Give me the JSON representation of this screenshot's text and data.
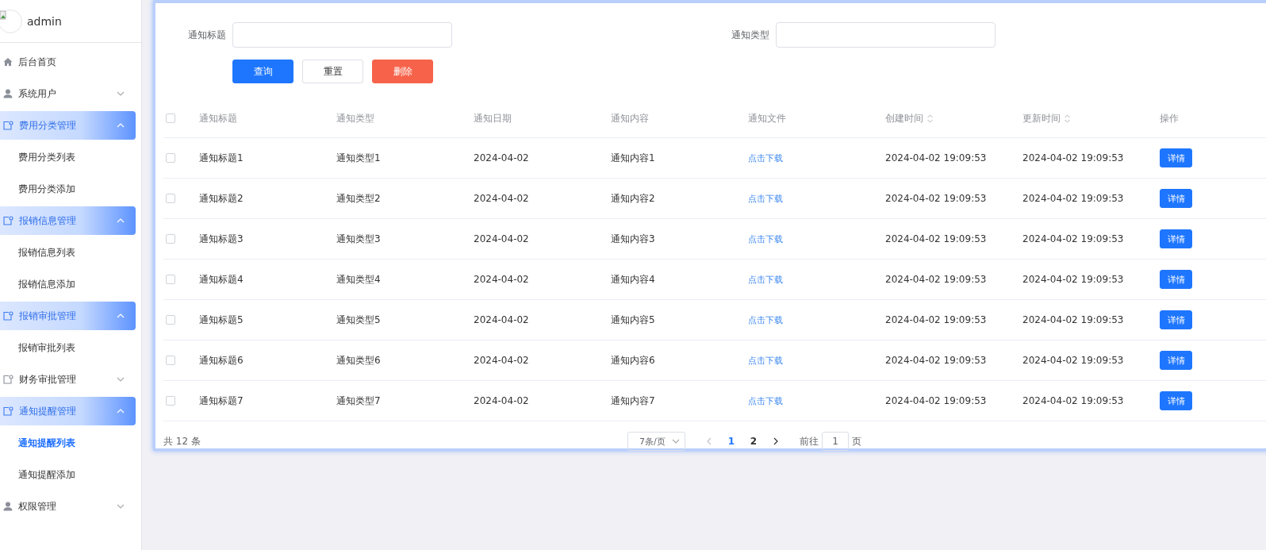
{
  "sidebar": {
    "user": {
      "name": "admin"
    },
    "items": [
      {
        "label": "后台首页",
        "kind": "home"
      },
      {
        "label": "系统用户",
        "kind": "people",
        "expanded": false
      },
      {
        "label": "费用分类管理",
        "kind": "folder",
        "expanded": true,
        "children": [
          {
            "label": "费用分类列表",
            "selected": false
          },
          {
            "label": "费用分类添加",
            "selected": false
          }
        ]
      },
      {
        "label": "报销信息管理",
        "kind": "folder",
        "expanded": true,
        "children": [
          {
            "label": "报销信息列表",
            "selected": false
          },
          {
            "label": "报销信息添加",
            "selected": false
          }
        ]
      },
      {
        "label": "报销审批管理",
        "kind": "folder",
        "expanded": true,
        "children": [
          {
            "label": "报销审批列表",
            "selected": false
          }
        ]
      },
      {
        "label": "财务审批管理",
        "kind": "folder",
        "expanded": false
      },
      {
        "label": "通知提醒管理",
        "kind": "folder",
        "expanded": true,
        "children": [
          {
            "label": "通知提醒列表",
            "selected": true
          },
          {
            "label": "通知提醒添加",
            "selected": false
          }
        ]
      },
      {
        "label": "权限管理",
        "kind": "people",
        "expanded": false
      }
    ]
  },
  "search": {
    "fields": [
      {
        "label": "通知标题"
      },
      {
        "label": "通知类型"
      }
    ],
    "buttons": [
      {
        "label": "查询",
        "kind": "primary"
      },
      {
        "label": "重置",
        "kind": "plain"
      },
      {
        "label": "删除",
        "kind": "danger"
      }
    ]
  },
  "table": {
    "all_checked": false,
    "columns": [
      {
        "label": "通知标题",
        "sortable": false
      },
      {
        "label": "通知类型",
        "sortable": false
      },
      {
        "label": "通知日期",
        "sortable": false
      },
      {
        "label": "通知内容",
        "sortable": false
      },
      {
        "label": "通知文件",
        "sortable": false
      },
      {
        "label": "创建时间",
        "sortable": true
      },
      {
        "label": "更新时间",
        "sortable": true
      },
      {
        "label": "操作",
        "sortable": false
      }
    ],
    "rows": [
      {
        "checked": false,
        "cells": [
          "通知标题1",
          "通知类型1",
          "2024-04-02",
          "通知内容1"
        ],
        "file": "点击下载",
        "created": "2024-04-02 19:09:53",
        "updated": "2024-04-02 19:09:53",
        "action": "详情"
      },
      {
        "checked": false,
        "cells": [
          "通知标题2",
          "通知类型2",
          "2024-04-02",
          "通知内容2"
        ],
        "file": "点击下载",
        "created": "2024-04-02 19:09:53",
        "updated": "2024-04-02 19:09:53",
        "action": "详情"
      },
      {
        "checked": false,
        "cells": [
          "通知标题3",
          "通知类型3",
          "2024-04-02",
          "通知内容3"
        ],
        "file": "点击下载",
        "created": "2024-04-02 19:09:53",
        "updated": "2024-04-02 19:09:53",
        "action": "详情"
      },
      {
        "checked": false,
        "cells": [
          "通知标题4",
          "通知类型4",
          "2024-04-02",
          "通知内容4"
        ],
        "file": "点击下载",
        "created": "2024-04-02 19:09:53",
        "updated": "2024-04-02 19:09:53",
        "action": "详情"
      },
      {
        "checked": false,
        "cells": [
          "通知标题5",
          "通知类型5",
          "2024-04-02",
          "通知内容5"
        ],
        "file": "点击下载",
        "created": "2024-04-02 19:09:53",
        "updated": "2024-04-02 19:09:53",
        "action": "详情"
      },
      {
        "checked": false,
        "cells": [
          "通知标题6",
          "通知类型6",
          "2024-04-02",
          "通知内容6"
        ],
        "file": "点击下载",
        "created": "2024-04-02 19:09:53",
        "updated": "2024-04-02 19:09:53",
        "action": "详情"
      },
      {
        "checked": false,
        "cells": [
          "通知标题7",
          "通知类型7",
          "2024-04-02",
          "通知内容7"
        ],
        "file": "点击下载",
        "created": "2024-04-02 19:09:53",
        "updated": "2024-04-02 19:09:53",
        "action": "详情"
      }
    ]
  },
  "pager": {
    "total": "共 12 条",
    "page_size": "7条/页",
    "prev_disabled": true,
    "next_disabled": false,
    "pages": [
      {
        "label": "1",
        "selected": true
      },
      {
        "label": "2",
        "selected": false
      }
    ],
    "goto_label": "前往",
    "goto_value": "1",
    "page_unit": "页"
  }
}
